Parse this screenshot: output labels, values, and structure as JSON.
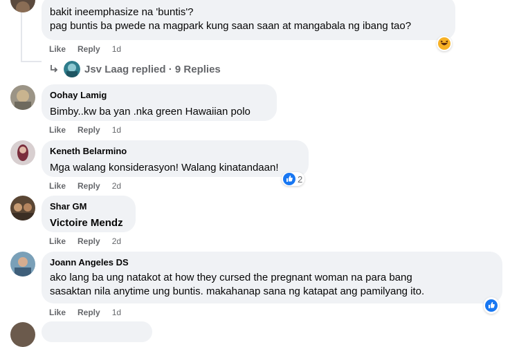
{
  "comments": [
    {
      "author": "",
      "lines": [
        "bakit ineemphasize na 'buntis'?",
        "pag buntis ba pwede na magpark kung saan saan at mangabala ng ibang tao?"
      ],
      "like_label": "Like",
      "reply_label": "Reply",
      "time": "1d",
      "reaction": "haha"
    },
    {
      "author": "Oohay Lamig",
      "lines": [
        "Bimby..kw ba yan .nka green Hawaiian polo"
      ],
      "like_label": "Like",
      "reply_label": "Reply",
      "time": "1d"
    },
    {
      "author": "Keneth Belarmino",
      "lines": [
        "Mga walang konsiderasyon! Walang kinatandaan!"
      ],
      "like_label": "Like",
      "reply_label": "Reply",
      "time": "2d",
      "reaction": "like",
      "reaction_count": "2"
    },
    {
      "author": "Shar GM",
      "lines": [
        "Victoire Mendz"
      ],
      "like_label": "Like",
      "reply_label": "Reply",
      "time": "2d"
    },
    {
      "author": "Joann Angeles DS",
      "lines": [
        "ako lang ba ung natakot at how they cursed the pregnant woman na para bang",
        "sasaktan nila anytime ung buntis. makahanap sana ng katapat ang pamilyang ito."
      ],
      "like_label": "Like",
      "reply_label": "Reply",
      "time": "1d",
      "reaction": "like"
    }
  ],
  "replies_link": {
    "text": "Jsv Laag replied · 9 Replies",
    "icon": "reply-arrow-icon"
  },
  "colors": {
    "bubble": "#f0f2f5",
    "meta": "#65676b",
    "like_blue": "#1877f2",
    "haha_yellow": "#f7b125"
  }
}
